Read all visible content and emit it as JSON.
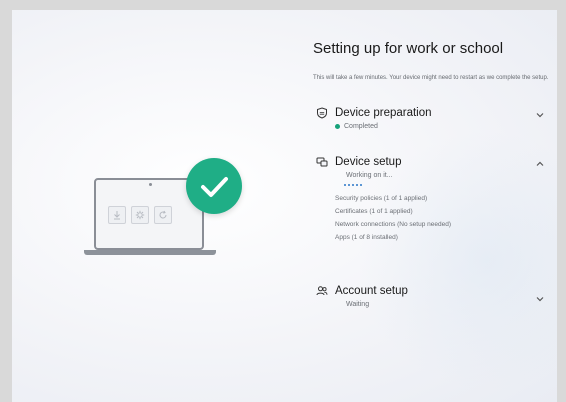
{
  "title": "Setting up for work or school",
  "description": "This will take a few minutes. Your device might need to restart as we complete the setup.",
  "sections": [
    {
      "title": "Device preparation",
      "status": "Completed",
      "icon": "shield-icon",
      "expanded": false
    },
    {
      "title": "Device setup",
      "status": "Working on it...",
      "icon": "devices-icon",
      "expanded": true,
      "items": [
        "Security policies (1 of 1 applied)",
        "Certificates (1 of 1 applied)",
        "Network connections (No setup needed)",
        "Apps (1 of 8 installed)"
      ]
    },
    {
      "title": "Account setup",
      "status": "Waiting",
      "icon": "people-icon",
      "expanded": false
    }
  ],
  "colors": {
    "accent_green": "#1fae86",
    "progress_blue": "#2a76c8",
    "background": "#f3f4f8"
  }
}
